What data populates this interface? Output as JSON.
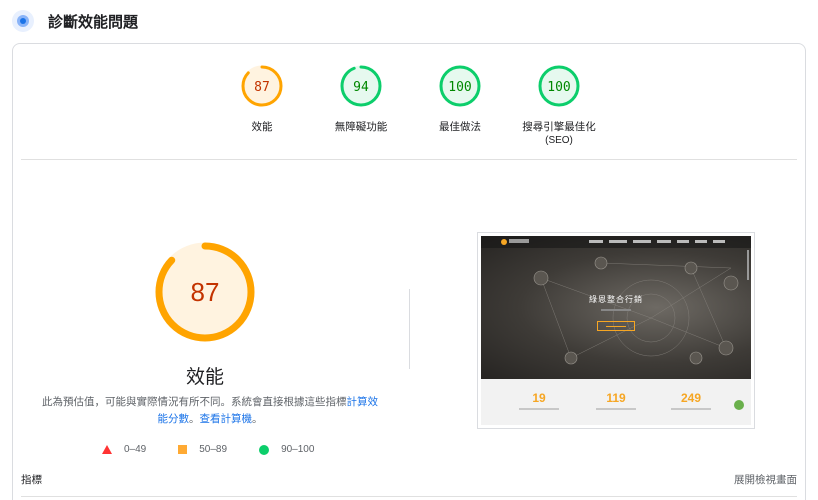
{
  "header": {
    "title": "診斷效能問題",
    "icon": "lighthouse-icon"
  },
  "categories": [
    {
      "score": "87",
      "label": "效能",
      "label2": "",
      "status": "average",
      "color": "#ffa400",
      "text_color": "#c33300",
      "fraction": 0.87
    },
    {
      "score": "94",
      "label": "無障礙功能",
      "label2": "",
      "status": "pass",
      "color": "#0cce6b",
      "text_color": "#008800",
      "fraction": 0.94
    },
    {
      "score": "100",
      "label": "最佳做法",
      "label2": "",
      "status": "pass",
      "color": "#0cce6b",
      "text_color": "#008800",
      "fraction": 1.0
    },
    {
      "score": "100",
      "label": "搜尋引擎最佳化",
      "label2": "(SEO)",
      "status": "pass",
      "color": "#0cce6b",
      "text_color": "#008800",
      "fraction": 1.0
    }
  ],
  "performance": {
    "score": "87",
    "fraction": 0.87,
    "title": "效能",
    "color": "#ffa400",
    "description_prefix": "此為預估值，可能與實際情況有所不同。系統會直接根據這些指標",
    "link1": "計算效能分數",
    "separator": "。",
    "link2": "查看計算機",
    "suffix": "。"
  },
  "legend": [
    {
      "shape": "triangle",
      "range": "0–49",
      "color": "#ff3333"
    },
    {
      "shape": "square",
      "range": "50–89",
      "color": "#ffaa33"
    },
    {
      "shape": "circle",
      "range": "90–100",
      "color": "#0cce6b"
    }
  ],
  "screenshot": {
    "hero_title": "綠恩整合行銷",
    "stats": [
      "19",
      "119",
      "249"
    ]
  },
  "metrics": {
    "label": "指標",
    "expand_label": "展開檢視畫面"
  }
}
